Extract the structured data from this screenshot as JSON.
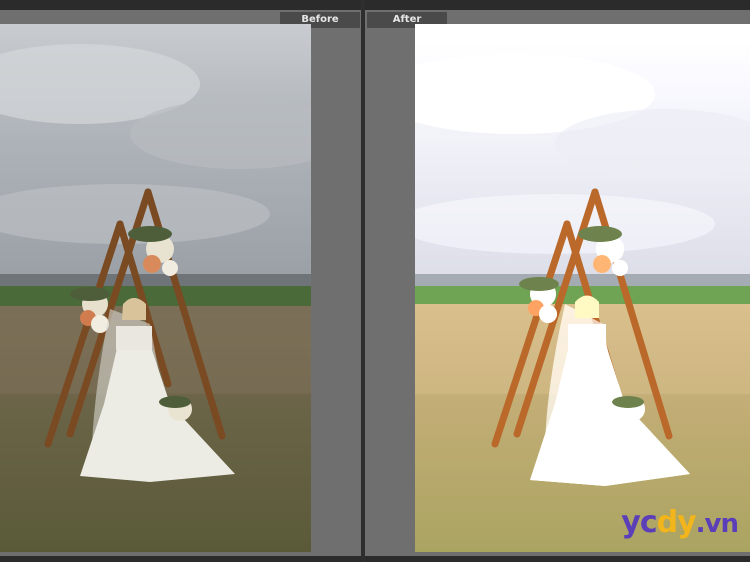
{
  "compare_view": {
    "before_label": "Before",
    "after_label": "After"
  },
  "watermark": {
    "brand_y": "y",
    "brand_c": "c",
    "brand_d": "d",
    "brand_y2": "y",
    "brand_vn": ".vn"
  },
  "colors": {
    "pane_bg": "#6f6f6f",
    "label_bg": "#4a4a4a",
    "watermark_purple": "#5b3fb8",
    "watermark_yellow": "#f2b51b"
  }
}
